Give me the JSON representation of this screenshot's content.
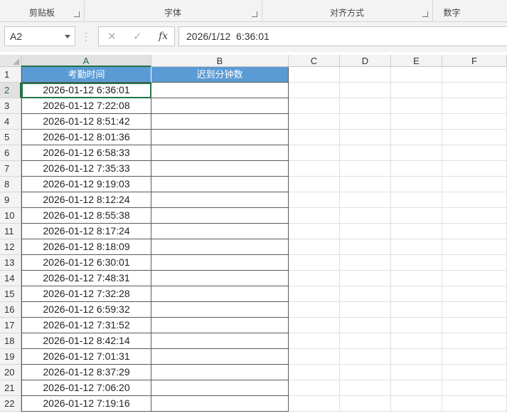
{
  "ribbon": {
    "groups": [
      {
        "label": "剪贴板",
        "launcher": true
      },
      {
        "label": "字体",
        "launcher": true
      },
      {
        "label": "对齐方式",
        "launcher": true
      },
      {
        "label": "数字",
        "launcher": false
      }
    ]
  },
  "formula_bar": {
    "name_box": "A2",
    "cancel_icon": "✕",
    "enter_icon": "✓",
    "fx_label": "fx",
    "formula": "2026/1/12  6:36:01"
  },
  "sheet": {
    "columns": [
      "A",
      "B",
      "C",
      "D",
      "E",
      "F"
    ],
    "active_column": "A",
    "active_row": 2,
    "header_color": "#5b9bd5",
    "selection_color": "#217346",
    "header_row": [
      "考勤时间",
      "迟到分钟数"
    ],
    "rows": [
      {
        "num": "1"
      },
      {
        "num": "2",
        "time": "2026-01-12 6:36:01",
        "late": ""
      },
      {
        "num": "3",
        "time": "2026-01-12 7:22:08",
        "late": ""
      },
      {
        "num": "4",
        "time": "2026-01-12 8:51:42",
        "late": ""
      },
      {
        "num": "5",
        "time": "2026-01-12 8:01:36",
        "late": ""
      },
      {
        "num": "6",
        "time": "2026-01-12 6:58:33",
        "late": ""
      },
      {
        "num": "7",
        "time": "2026-01-12 7:35:33",
        "late": ""
      },
      {
        "num": "8",
        "time": "2026-01-12 9:19:03",
        "late": ""
      },
      {
        "num": "9",
        "time": "2026-01-12 8:12:24",
        "late": ""
      },
      {
        "num": "10",
        "time": "2026-01-12 8:55:38",
        "late": ""
      },
      {
        "num": "11",
        "time": "2026-01-12 8:17:24",
        "late": ""
      },
      {
        "num": "12",
        "time": "2026-01-12 8:18:09",
        "late": ""
      },
      {
        "num": "13",
        "time": "2026-01-12 6:30:01",
        "late": ""
      },
      {
        "num": "14",
        "time": "2026-01-12 7:48:31",
        "late": ""
      },
      {
        "num": "15",
        "time": "2026-01-12 7:32:28",
        "late": ""
      },
      {
        "num": "16",
        "time": "2026-01-12 6:59:32",
        "late": ""
      },
      {
        "num": "17",
        "time": "2026-01-12 7:31:52",
        "late": ""
      },
      {
        "num": "18",
        "time": "2026-01-12 8:42:14",
        "late": ""
      },
      {
        "num": "19",
        "time": "2026-01-12 7:01:31",
        "late": ""
      },
      {
        "num": "20",
        "time": "2026-01-12 8:37:29",
        "late": ""
      },
      {
        "num": "21",
        "time": "2026-01-12 7:06:20",
        "late": ""
      },
      {
        "num": "22",
        "time": "2026-01-12 7:19:16",
        "late": ""
      }
    ]
  }
}
